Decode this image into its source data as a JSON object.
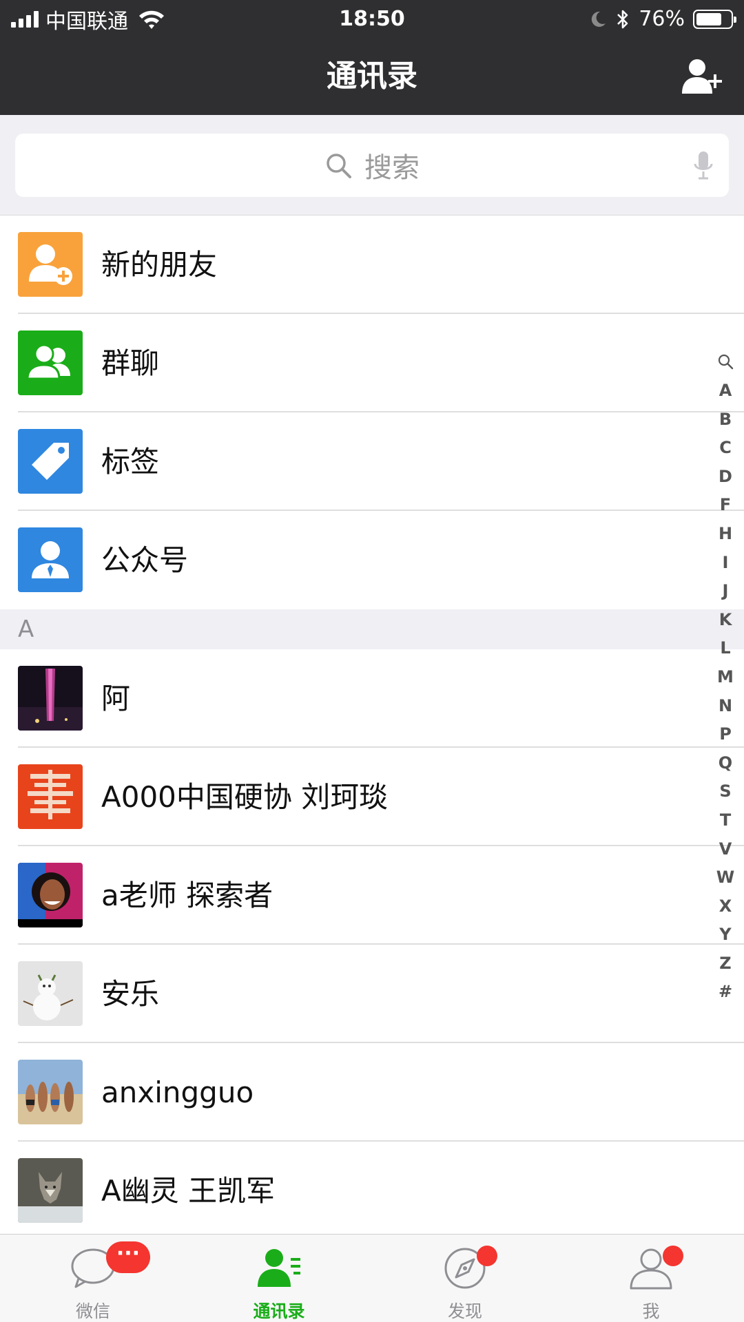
{
  "status_bar": {
    "carrier": "中国联通",
    "time": "18:50",
    "battery_percent": "76%",
    "battery_level": 0.76
  },
  "nav": {
    "title": "通讯录",
    "add_icon": "add-contact-icon"
  },
  "search": {
    "placeholder": "搜索",
    "icons": [
      "search-icon",
      "microphone-icon"
    ]
  },
  "function_items": [
    {
      "label": "新的朋友",
      "icon": "new-friend-icon",
      "color": "#f9a23b"
    },
    {
      "label": "群聊",
      "icon": "group-chat-icon",
      "color": "#1aad19"
    },
    {
      "label": "标签",
      "icon": "tag-icon",
      "color": "#2f87e0"
    },
    {
      "label": "公众号",
      "icon": "official-account-icon",
      "color": "#2f87e0"
    }
  ],
  "section": {
    "letter": "A"
  },
  "contacts": [
    {
      "name": "阿",
      "avatar": "night-tower-photo"
    },
    {
      "name": "A000中国硬协 刘珂琰",
      "avatar": "red-calligraphy-logo"
    },
    {
      "name": "a老师 探索者",
      "avatar": "smiling-woman-photo"
    },
    {
      "name": "安乐",
      "avatar": "snowman-photo"
    },
    {
      "name": "anxingguo",
      "avatar": "beach-group-photo"
    },
    {
      "name": "A幽灵 王凯军",
      "avatar": "wolf-photo"
    }
  ],
  "index_letters": [
    "A",
    "B",
    "C",
    "D",
    "F",
    "H",
    "I",
    "J",
    "K",
    "L",
    "M",
    "N",
    "P",
    "Q",
    "S",
    "T",
    "V",
    "W",
    "X",
    "Y",
    "Z",
    "#"
  ],
  "tabs": [
    {
      "label": "微信",
      "icon": "chat-bubble-icon",
      "badge": "···"
    },
    {
      "label": "通讯录",
      "icon": "contacts-icon",
      "active": true
    },
    {
      "label": "发现",
      "icon": "compass-icon",
      "dot": true
    },
    {
      "label": "我",
      "icon": "profile-icon",
      "dot": true
    }
  ],
  "colors": {
    "bar_dark": "#2f2f31",
    "accent_green": "#1aad19",
    "badge_red": "#f43530",
    "section_bg": "#efeff4"
  }
}
